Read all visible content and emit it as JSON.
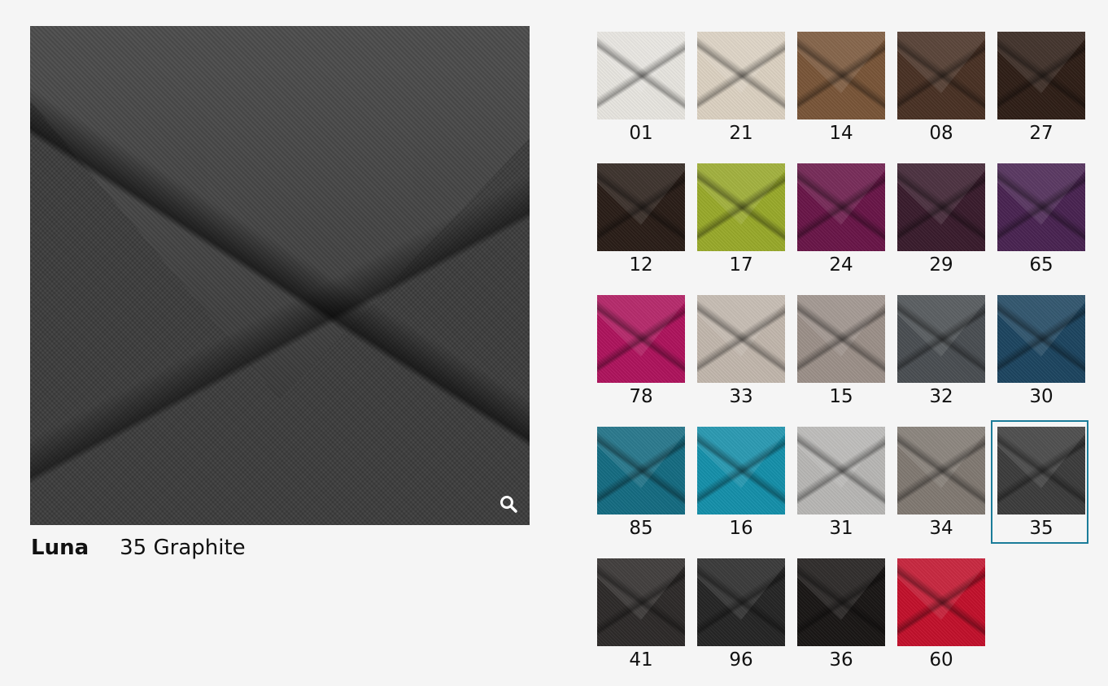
{
  "product": {
    "name": "Luna",
    "selected_label": "35 Graphite",
    "zoom_icon": "search-icon"
  },
  "colors": {
    "selected_border": "#1b7c99"
  },
  "swatches": [
    {
      "code": "01",
      "color": "#e9e7e1"
    },
    {
      "code": "21",
      "color": "#ddd3c3"
    },
    {
      "code": "14",
      "color": "#7a5639"
    },
    {
      "code": "08",
      "color": "#4a3225"
    },
    {
      "code": "27",
      "color": "#2f1f17"
    },
    {
      "code": "12",
      "color": "#2a1e18"
    },
    {
      "code": "17",
      "color": "#9aab2b"
    },
    {
      "code": "24",
      "color": "#6a1649"
    },
    {
      "code": "29",
      "color": "#3a1c2d"
    },
    {
      "code": "65",
      "color": "#4a2452"
    },
    {
      "code": "78",
      "color": "#b0145e"
    },
    {
      "code": "33",
      "color": "#c3b8ae"
    },
    {
      "code": "15",
      "color": "#9d918a"
    },
    {
      "code": "32",
      "color": "#4b4f53"
    },
    {
      "code": "30",
      "color": "#1d4661"
    },
    {
      "code": "85",
      "color": "#156d83"
    },
    {
      "code": "16",
      "color": "#1591ac"
    },
    {
      "code": "31",
      "color": "#b9b8b6"
    },
    {
      "code": "34",
      "color": "#827a73"
    },
    {
      "code": "35",
      "color": "#3d3d3d",
      "selected": true
    },
    {
      "code": "41",
      "color": "#2e2b2a"
    },
    {
      "code": "96",
      "color": "#262626"
    },
    {
      "code": "36",
      "color": "#1a1716"
    },
    {
      "code": "60",
      "color": "#c4112c"
    }
  ]
}
